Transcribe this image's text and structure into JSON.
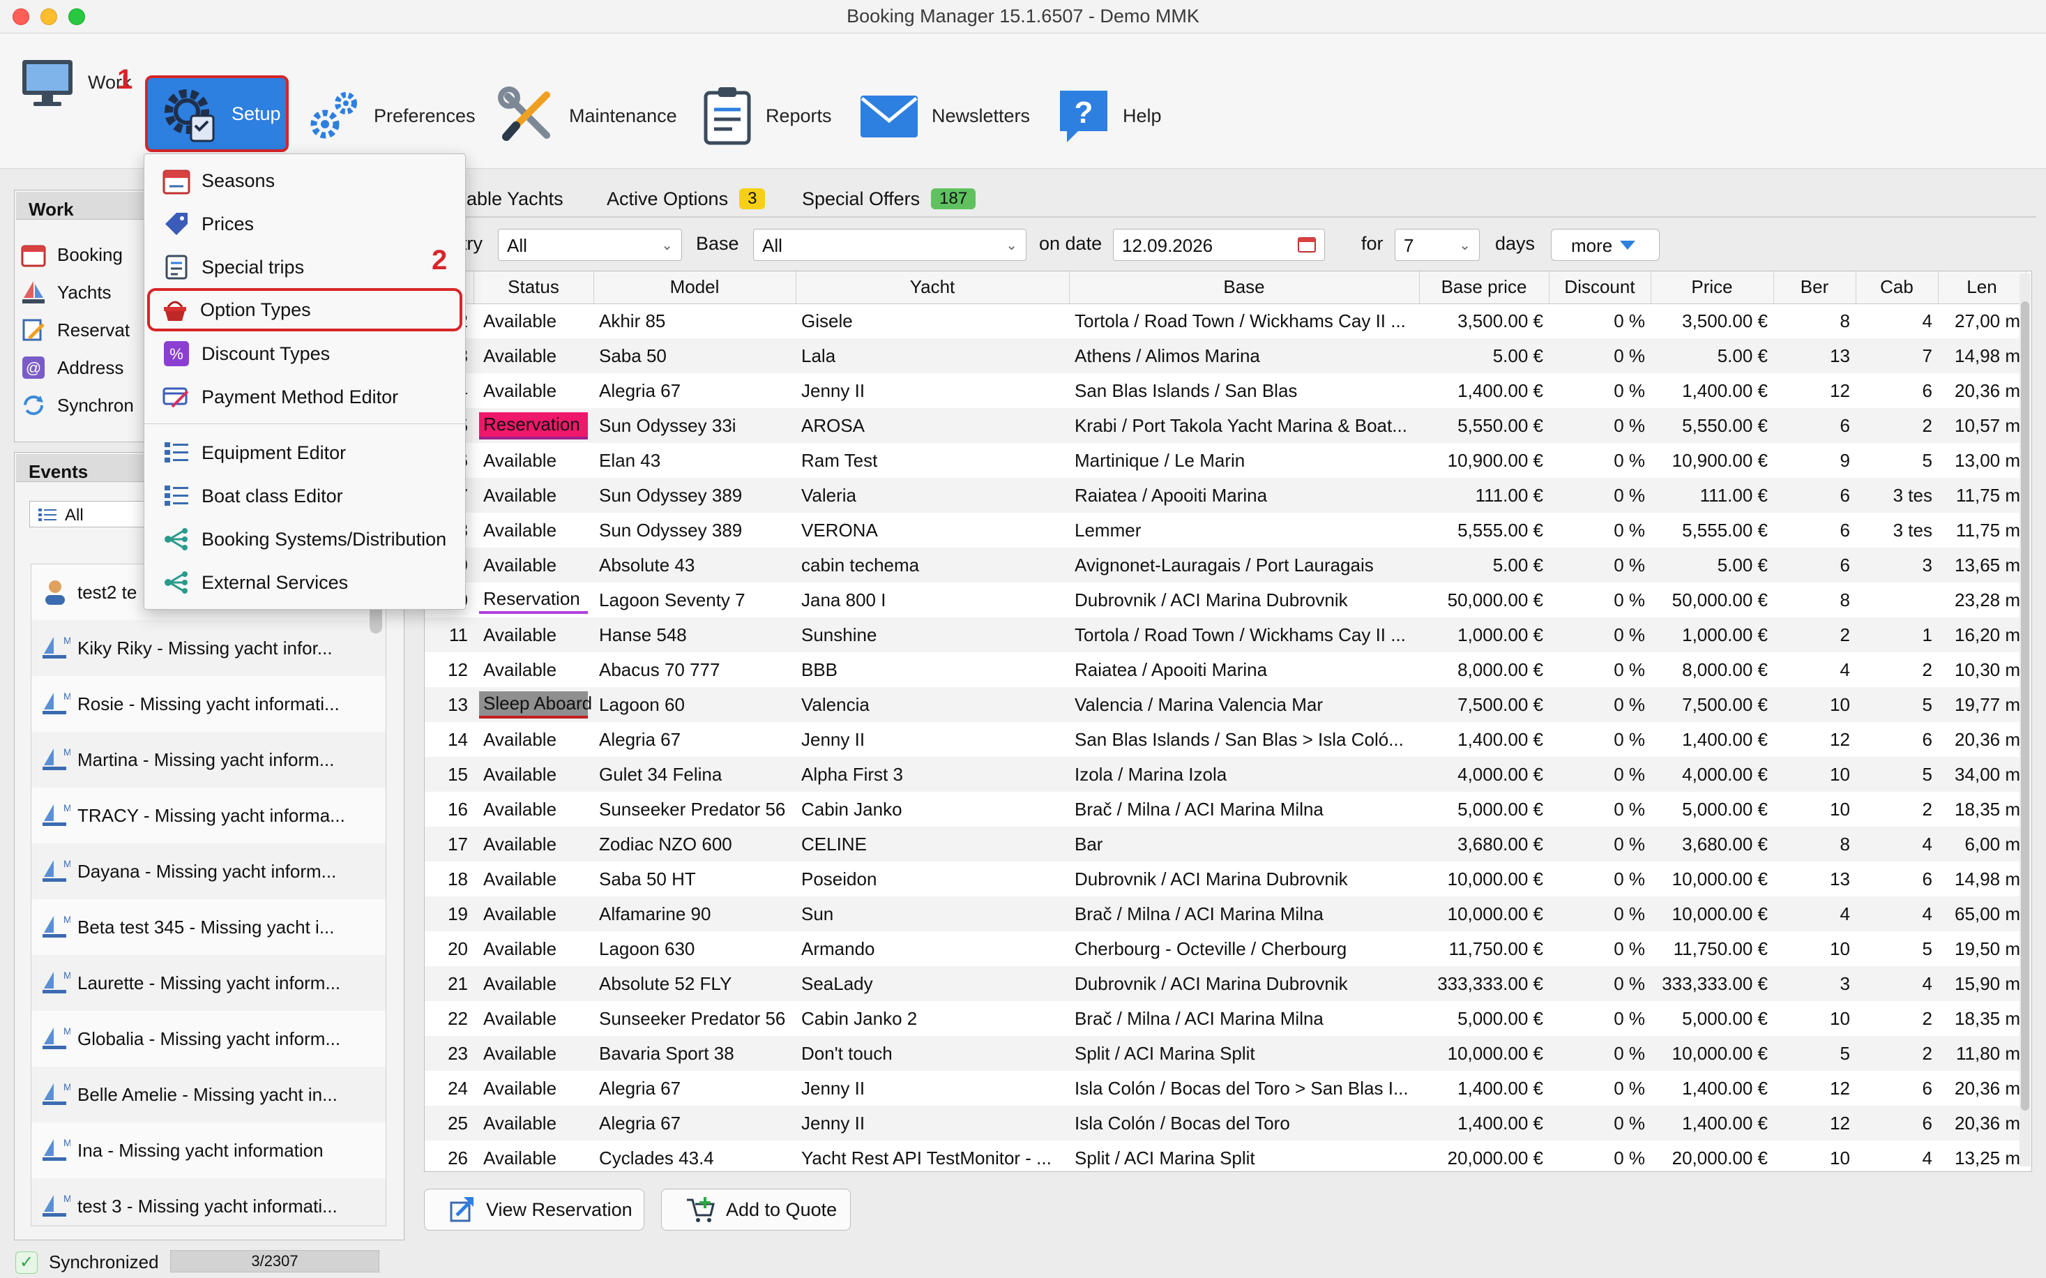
{
  "window": {
    "title": "Booking Manager 15.1.6507 - Demo MMK"
  },
  "toolbar": {
    "work": "Work",
    "setup": "Setup",
    "preferences": "Preferences",
    "maintenance": "Maintenance",
    "reports": "Reports",
    "newsletters": "Newsletters",
    "help": "Help"
  },
  "annotations": {
    "step1": "1",
    "step2": "2"
  },
  "setup_menu": {
    "items": [
      "Seasons",
      "Prices",
      "Special trips",
      "Option Types",
      "Discount Types",
      "Payment Method Editor",
      "Equipment Editor",
      "Boat class Editor",
      "Booking Systems/Distribution",
      "External Services"
    ],
    "highlighted": "Option Types"
  },
  "work_panel": {
    "title": "Work",
    "items": [
      "Booking",
      "Yachts",
      "Reservat",
      "Address",
      "Synchron"
    ]
  },
  "events_panel": {
    "title": "Events",
    "filter": "All",
    "items": [
      "test2 te",
      "Kiky Riky - Missing yacht infor...",
      "Rosie - Missing yacht informati...",
      "Martina - Missing yacht inform...",
      "TRACY - Missing yacht informa...",
      "Dayana - Missing yacht inform...",
      "Beta test 345 - Missing yacht i...",
      "Laurette - Missing yacht inform...",
      "Globalia - Missing yacht inform...",
      "Belle Amelie - Missing yacht in...",
      "Ina - Missing yacht information",
      "test 3 - Missing yacht informati..."
    ]
  },
  "tabs": [
    {
      "label": "ailable Yachts"
    },
    {
      "label": "Active Options",
      "badge": "3"
    },
    {
      "label": "Special Offers",
      "badge": "187"
    }
  ],
  "filters": {
    "country_label": "try",
    "country_value": "All",
    "base_label": "Base",
    "base_value": "All",
    "date_label": "on date",
    "date_value": "12.09.2026",
    "for_label": "for",
    "days_value": "7",
    "days_label": "days",
    "more": "more"
  },
  "table": {
    "columns": [
      "Status",
      "Model",
      "Yacht",
      "Base",
      "Base price",
      "Discount",
      "Price",
      "Ber",
      "Cab",
      "Len"
    ],
    "rows": [
      {
        "n": "2",
        "status": "Available",
        "model": "Akhir 85",
        "yacht": "Gisele",
        "base": "Tortola / Road Town / Wickhams Cay II ...",
        "base_price": "3,500.00 €",
        "discount": "0 %",
        "price": "3,500.00 €",
        "ber": "8",
        "cab": "4",
        "len": "27,00 m"
      },
      {
        "n": "3",
        "status": "Available",
        "model": "Saba 50",
        "yacht": "Lala",
        "base": "Athens / Alimos Marina",
        "base_price": "5.00 €",
        "discount": "0 %",
        "price": "5.00 €",
        "ber": "13",
        "cab": "7",
        "len": "14,98 m"
      },
      {
        "n": "4",
        "status": "Available",
        "model": "Alegria 67",
        "yacht": "Jenny II",
        "base": "San Blas Islands / San Blas",
        "base_price": "1,400.00 €",
        "discount": "0 %",
        "price": "1,400.00 €",
        "ber": "12",
        "cab": "6",
        "len": "20,36 m"
      },
      {
        "n": "5",
        "status": "Reservation",
        "model": "Sun Odyssey 33i",
        "yacht": "AROSA",
        "base": "Krabi / Port Takola Yacht Marina & Boat...",
        "base_price": "5,550.00 €",
        "discount": "0 %",
        "price": "5,550.00 €",
        "ber": "6",
        "cab": "2",
        "len": "10,57 m"
      },
      {
        "n": "6",
        "status": "Available",
        "model": "Elan 43",
        "yacht": "Ram Test",
        "base": "Martinique / Le Marin",
        "base_price": "10,900.00 €",
        "discount": "0 %",
        "price": "10,900.00 €",
        "ber": "9",
        "cab": "5",
        "len": "13,00 m"
      },
      {
        "n": "7",
        "status": "Available",
        "model": "Sun Odyssey 389",
        "yacht": "Valeria",
        "base": "Raiatea / Apooiti Marina",
        "base_price": "111.00 €",
        "discount": "0 %",
        "price": "111.00 €",
        "ber": "6",
        "cab": "3 tes",
        "len": "11,75 m"
      },
      {
        "n": "8",
        "status": "Available",
        "model": "Sun Odyssey 389",
        "yacht": "VERONA",
        "base": "Lemmer",
        "base_price": "5,555.00 €",
        "discount": "0 %",
        "price": "5,555.00 €",
        "ber": "6",
        "cab": "3 tes",
        "len": "11,75 m"
      },
      {
        "n": "9",
        "status": "Available",
        "model": "Absolute 43",
        "yacht": "cabin techema",
        "base": "Avignonet-Lauragais / Port Lauragais",
        "base_price": "5.00 €",
        "discount": "0 %",
        "price": "5.00 €",
        "ber": "6",
        "cab": "3",
        "len": "13,65 m"
      },
      {
        "n": "0",
        "status": "Reservation",
        "model": "Lagoon Seventy 7",
        "yacht": "Jana 800 I",
        "base": "Dubrovnik / ACI Marina Dubrovnik",
        "base_price": "50,000.00 €",
        "discount": "0 %",
        "price": "50,000.00 €",
        "ber": "8",
        "cab": "",
        "len": "23,28 m"
      },
      {
        "n": "11",
        "status": "Available",
        "model": "Hanse 548",
        "yacht": "Sunshine",
        "base": "Tortola / Road Town / Wickhams Cay II ...",
        "base_price": "1,000.00 €",
        "discount": "0 %",
        "price": "1,000.00 €",
        "ber": "2",
        "cab": "1",
        "len": "16,20 m"
      },
      {
        "n": "12",
        "status": "Available",
        "model": "Abacus 70 777",
        "yacht": "BBB",
        "base": "Raiatea / Apooiti Marina",
        "base_price": "8,000.00 €",
        "discount": "0 %",
        "price": "8,000.00 €",
        "ber": "4",
        "cab": "2",
        "len": "10,30 m"
      },
      {
        "n": "13",
        "status": "Sleep Aboard",
        "model": "Lagoon 60",
        "yacht": "Valencia",
        "base": "Valencia / Marina Valencia Mar",
        "base_price": "7,500.00 €",
        "discount": "0 %",
        "price": "7,500.00 €",
        "ber": "10",
        "cab": "5",
        "len": "19,77 m"
      },
      {
        "n": "14",
        "status": "Available",
        "model": "Alegria 67",
        "yacht": "Jenny II",
        "base": "San Blas Islands / San Blas > Isla Coló...",
        "base_price": "1,400.00 €",
        "discount": "0 %",
        "price": "1,400.00 €",
        "ber": "12",
        "cab": "6",
        "len": "20,36 m"
      },
      {
        "n": "15",
        "status": "Available",
        "model": "Gulet 34 Felina",
        "yacht": "Alpha First 3",
        "base": "Izola / Marina Izola",
        "base_price": "4,000.00 €",
        "discount": "0 %",
        "price": "4,000.00 €",
        "ber": "10",
        "cab": "5",
        "len": "34,00 m"
      },
      {
        "n": "16",
        "status": "Available",
        "model": "Sunseeker Predator 56",
        "yacht": "Cabin Janko",
        "base": "Brač / Milna / ACI Marina Milna",
        "base_price": "5,000.00 €",
        "discount": "0 %",
        "price": "5,000.00 €",
        "ber": "10",
        "cab": "2",
        "len": "18,35 m"
      },
      {
        "n": "17",
        "status": "Available",
        "model": "Zodiac NZO 600",
        "yacht": "CELINE",
        "base": "Bar",
        "base_price": "3,680.00 €",
        "discount": "0 %",
        "price": "3,680.00 €",
        "ber": "8",
        "cab": "4",
        "len": "6,00 m"
      },
      {
        "n": "18",
        "status": "Available",
        "model": "Saba 50 HT",
        "yacht": "Poseidon",
        "base": "Dubrovnik / ACI Marina Dubrovnik",
        "base_price": "10,000.00 €",
        "discount": "0 %",
        "price": "10,000.00 €",
        "ber": "13",
        "cab": "6",
        "len": "14,98 m"
      },
      {
        "n": "19",
        "status": "Available",
        "model": "Alfamarine 90",
        "yacht": "Sun",
        "base": "Brač / Milna / ACI Marina Milna",
        "base_price": "10,000.00 €",
        "discount": "0 %",
        "price": "10,000.00 €",
        "ber": "4",
        "cab": "4",
        "len": "65,00 m"
      },
      {
        "n": "20",
        "status": "Available",
        "model": "Lagoon 630",
        "yacht": "Armando",
        "base": "Cherbourg - Octeville / Cherbourg",
        "base_price": "11,750.00 €",
        "discount": "0 %",
        "price": "11,750.00 €",
        "ber": "10",
        "cab": "5",
        "len": "19,50 m"
      },
      {
        "n": "21",
        "status": "Available",
        "model": "Absolute 52 FLY",
        "yacht": "SeaLady",
        "base": "Dubrovnik / ACI Marina Dubrovnik",
        "base_price": "333,333.00 €",
        "discount": "0 %",
        "price": "333,333.00 €",
        "ber": "3",
        "cab": "4",
        "len": "15,90 m"
      },
      {
        "n": "22",
        "status": "Available",
        "model": "Sunseeker Predator 56",
        "yacht": "Cabin Janko 2",
        "base": "Brač / Milna / ACI Marina Milna",
        "base_price": "5,000.00 €",
        "discount": "0 %",
        "price": "5,000.00 €",
        "ber": "10",
        "cab": "2",
        "len": "18,35 m"
      },
      {
        "n": "23",
        "status": "Available",
        "model": "Bavaria Sport 38",
        "yacht": "Don't touch",
        "base": "Split / ACI Marina Split",
        "base_price": "10,000.00 €",
        "discount": "0 %",
        "price": "10,000.00 €",
        "ber": "5",
        "cab": "2",
        "len": "11,80 m"
      },
      {
        "n": "24",
        "status": "Available",
        "model": "Alegria 67",
        "yacht": "Jenny II",
        "base": "Isla Colón / Bocas del Toro > San Blas I...",
        "base_price": "1,400.00 €",
        "discount": "0 %",
        "price": "1,400.00 €",
        "ber": "12",
        "cab": "6",
        "len": "20,36 m"
      },
      {
        "n": "25",
        "status": "Available",
        "model": "Alegria 67",
        "yacht": "Jenny II",
        "base": "Isla Colón / Bocas del Toro",
        "base_price": "1,400.00 €",
        "discount": "0 %",
        "price": "1,400.00 €",
        "ber": "12",
        "cab": "6",
        "len": "20,36 m"
      },
      {
        "n": "26",
        "status": "Available",
        "model": "Cyclades 43.4",
        "yacht": "Yacht Rest API TestMonitor - ...",
        "base": "Split / ACI Marina Split",
        "base_price": "20,000.00 €",
        "discount": "0 %",
        "price": "20,000.00 €",
        "ber": "10",
        "cab": "4",
        "len": "13,25 m"
      }
    ]
  },
  "actions": {
    "view_reservation": "View Reservation",
    "add_to_quote": "Add to Quote"
  },
  "status": {
    "sync_text": "Synchronized",
    "progress_text": "3/2307"
  }
}
